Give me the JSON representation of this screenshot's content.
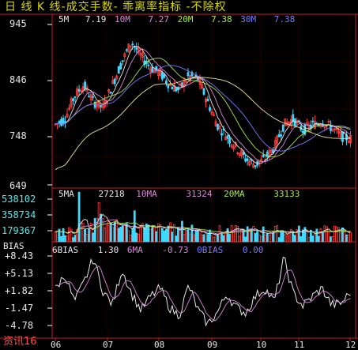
{
  "header": {
    "title": "日  线  K  线-成交手数- 乖离率指标     -不除权"
  },
  "price_panel": {
    "ma_labels": [
      {
        "label": "5M",
        "value": "7.19"
      },
      {
        "label": "10M",
        "value": "7.27"
      },
      {
        "label": "20M",
        "value": "7.38"
      },
      {
        "label": "30M",
        "value": "7.38"
      }
    ],
    "y_ticks": [
      "945",
      "846",
      "748",
      "649"
    ]
  },
  "volume_panel": {
    "ma_labels": [
      {
        "label": "5MA",
        "value": "27218"
      },
      {
        "label": "10MA",
        "value": "31324"
      },
      {
        "label": "20MA",
        "value": "33133"
      }
    ],
    "y_ticks": [
      "538102",
      "358734",
      "179367"
    ]
  },
  "bias_panel": {
    "name": "BIAS",
    "labels": [
      {
        "label": "6BIAS",
        "value": "1.30"
      },
      {
        "label": "6MA",
        "value": "-0.73"
      },
      {
        "label": "0BIAS",
        "value": "0.00"
      }
    ],
    "y_ticks": [
      "+8.43",
      "+5.13",
      "+1.82",
      "-1.47",
      "-4.78"
    ]
  },
  "x_axis": [
    "06",
    "07",
    "08",
    "09",
    "10",
    "11",
    "12"
  ],
  "source_label": "资讯16",
  "colors": {
    "up": "#ff3b3b",
    "down": "#3fd9ff",
    "frame": "#c02020",
    "ma5": "#e8e8e8",
    "ma10": "#d78ad7",
    "ma20": "#a6e84a",
    "ma30": "#7a7aff",
    "long_ma": "#e8e8a0",
    "tick_label": "#59e8e8"
  },
  "chart_data": {
    "type": "candlestick",
    "price_axis": {
      "ylim": [
        649,
        945
      ]
    },
    "volume_axis": {
      "ylim": [
        0,
        538102
      ]
    },
    "bias_axis": {
      "ylim": [
        -4.78,
        8.43
      ]
    },
    "months": [
      "06",
      "07",
      "08",
      "09",
      "10",
      "11",
      "12"
    ],
    "close_trend": [
      760,
      770,
      810,
      830,
      800,
      790,
      830,
      870,
      905,
      880,
      860,
      850,
      830,
      820,
      845,
      840,
      800,
      760,
      740,
      720,
      700,
      690,
      700,
      720,
      760,
      770,
      750,
      760,
      765,
      755,
      740,
      735
    ],
    "bias_trend": [
      1.8,
      4.5,
      -0.5,
      3.0,
      7.5,
      1.5,
      -1.0,
      5.5,
      1.0,
      -2.0,
      0.5,
      2.0,
      -1.5,
      -3.0,
      2.5,
      -2.0,
      -4.5,
      -2.5,
      1.0,
      -1.5,
      -2.5,
      0.5,
      2.0,
      -0.5,
      7.5,
      1.0,
      -1.2,
      0.5,
      2.0,
      -1.0,
      -0.8,
      1.3
    ]
  }
}
